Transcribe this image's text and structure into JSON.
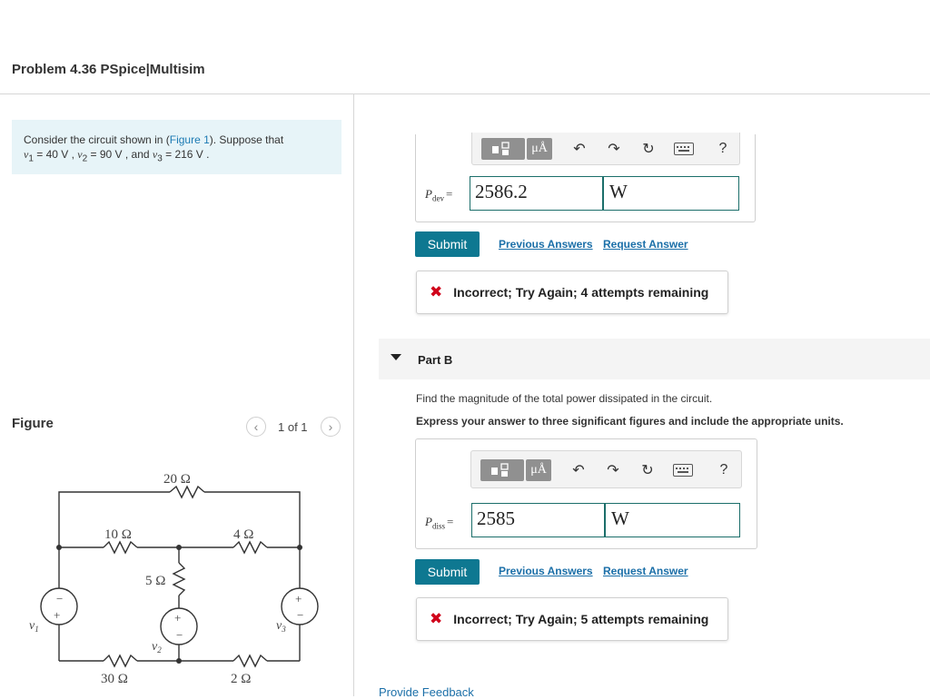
{
  "header": {
    "title": "Problem 4.36 PSpice|Multisim"
  },
  "problem": {
    "text_before_link": "Consider the circuit shown in (",
    "figure_link": "Figure 1",
    "text_after_link": "). Suppose that",
    "v1_name": "v",
    "v1_sub": "1",
    "v1_value": " = 40  V , ",
    "v2_name": "v",
    "v2_sub": "2",
    "v2_value": " = 90  V , and ",
    "v3_name": "v",
    "v3_sub": "3",
    "v3_value": " = 216  V ."
  },
  "figure": {
    "title": "Figure",
    "pager": "1 of 1",
    "prev_icon": "chevron-left-icon",
    "next_icon": "chevron-right-icon",
    "labels": {
      "r_top": "20 Ω",
      "r_left": "10 Ω",
      "r_mid_right": "4 Ω",
      "r_center": "5 Ω",
      "r_bottom_left": "30 Ω",
      "r_bottom_right": "2 Ω",
      "v1": "v",
      "v1_sub": "1",
      "v2": "v",
      "v2_sub": "2",
      "v3": "v",
      "v3_sub": "3",
      "plus": "+",
      "minus": "−"
    }
  },
  "toolbar": {
    "units_label": "μÅ",
    "help_label": "?",
    "icons": [
      "templates-icon",
      "units-icon",
      "undo-icon",
      "redo-icon",
      "reset-icon",
      "keyboard-icon",
      "help-icon"
    ]
  },
  "part_a": {
    "var_name": "P",
    "var_sub": "dev",
    "equals": "=",
    "value": "2586.2",
    "unit": "W",
    "submit": "Submit",
    "previous_answers": "Previous Answers",
    "request_answer": "Request Answer",
    "feedback": "Incorrect; Try Again; 4 attempts remaining"
  },
  "part_b": {
    "label": "Part B",
    "question": "Find the magnitude of the total power dissipated in the circuit.",
    "instruction": "Express your answer to three significant figures and include the appropriate units.",
    "var_name": "P",
    "var_sub": "diss",
    "equals": "=",
    "value": "2585",
    "unit": "W",
    "submit": "Submit",
    "previous_answers": "Previous Answers",
    "request_answer": "Request Answer",
    "feedback": "Incorrect; Try Again; 5 attempts remaining"
  },
  "footer": {
    "provide_feedback": "Provide Feedback"
  },
  "colors": {
    "accent": "#0e7891",
    "link": "#1b6fa8",
    "error": "#d0021b",
    "intro_bg": "#e7f4f8"
  }
}
